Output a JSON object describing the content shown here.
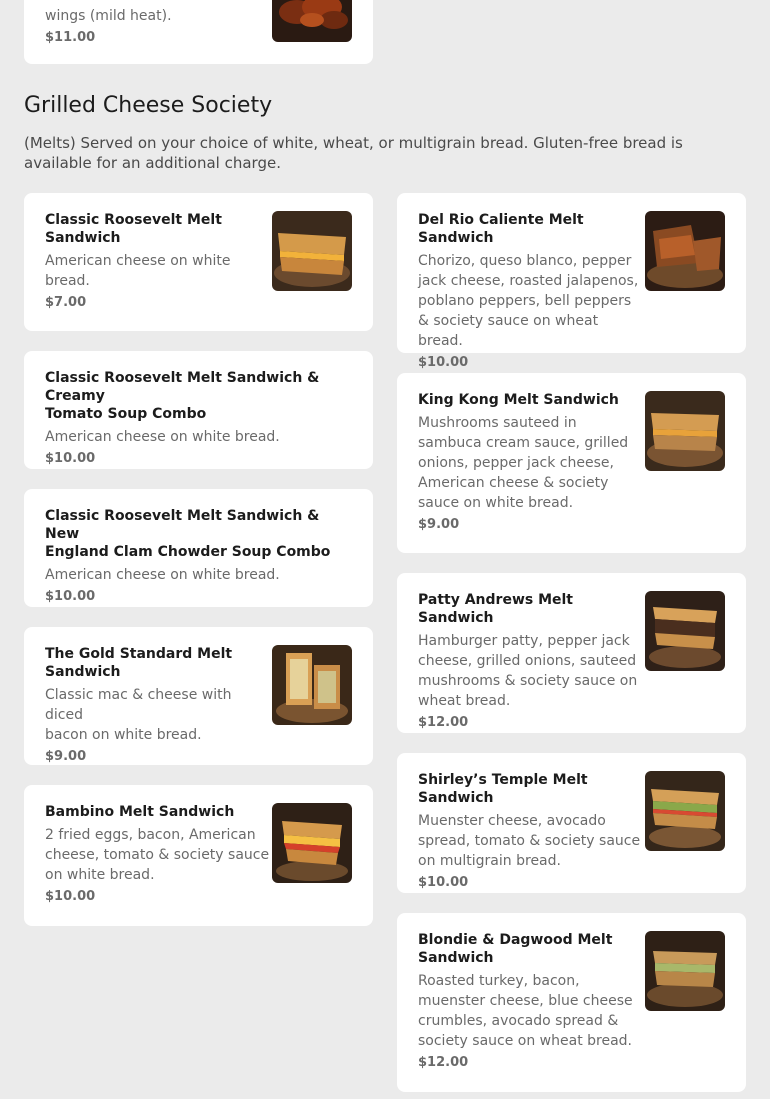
{
  "top_item": {
    "desc": "wings (mild heat).",
    "price": "$11.00"
  },
  "section": {
    "title": "Grilled Cheese Society",
    "description": "(Melts) Served on your choice of white, wheat, or multigrain bread. Gluten-free bread is available for an additional charge."
  },
  "items": [
    {
      "name": "Classic Roosevelt Melt\nSandwich",
      "desc": "American cheese on white\nbread.",
      "price": "$7.00",
      "image": "grilled-cheese-photo"
    },
    {
      "name": "Classic Roosevelt Melt Sandwich & Creamy\nTomato Soup Combo",
      "desc": "American cheese on white bread.",
      "price": "$10.00"
    },
    {
      "name": "Classic Roosevelt Melt Sandwich & New\nEngland Clam Chowder Soup Combo",
      "desc": "American cheese on white bread.",
      "price": "$10.00"
    },
    {
      "name": "The Gold Standard Melt\nSandwich",
      "desc": "Classic mac & cheese with diced\nbacon on white bread.",
      "price": "$9.00",
      "image": "mac-cheese-melt-photo"
    },
    {
      "name": "Bambino Melt Sandwich",
      "desc": "2 fried eggs, bacon, American\ncheese, tomato & society sauce\non white bread.",
      "price": "$10.00",
      "image": "egg-melt-photo"
    },
    {
      "name": "Del Rio Caliente Melt Sandwich",
      "desc": "Chorizo, queso blanco, pepper\njack cheese, roasted jalapenos,\npoblano peppers, bell peppers\n& society sauce on wheat bread.",
      "price": "$10.00",
      "image": "chorizo-melt-photo"
    },
    {
      "name": "King Kong Melt Sandwich",
      "desc": "Mushrooms sauteed in\nsambuca cream sauce, grilled\nonions, pepper jack cheese,\nAmerican cheese & society\nsauce on white bread.",
      "price": "$9.00",
      "image": "mushroom-melt-photo"
    },
    {
      "name": "Patty Andrews Melt Sandwich",
      "desc": "Hamburger patty, pepper jack\ncheese, grilled onions, sauteed\nmushrooms & society sauce on\nwheat bread.",
      "price": "$12.00",
      "image": "patty-melt-photo"
    },
    {
      "name": "Shirley’s Temple Melt Sandwich",
      "desc": "Muenster cheese, avocado\nspread, tomato & society sauce\non multigrain bread.",
      "price": "$10.00",
      "image": "avocado-melt-photo"
    },
    {
      "name": "Blondie & Dagwood Melt\nSandwich",
      "desc": "Roasted turkey, bacon,\nmuenster cheese, blue cheese\ncrumbles, avocado spread &\nsociety sauce on wheat bread.",
      "price": "$12.00",
      "image": "turkey-melt-photo"
    }
  ]
}
